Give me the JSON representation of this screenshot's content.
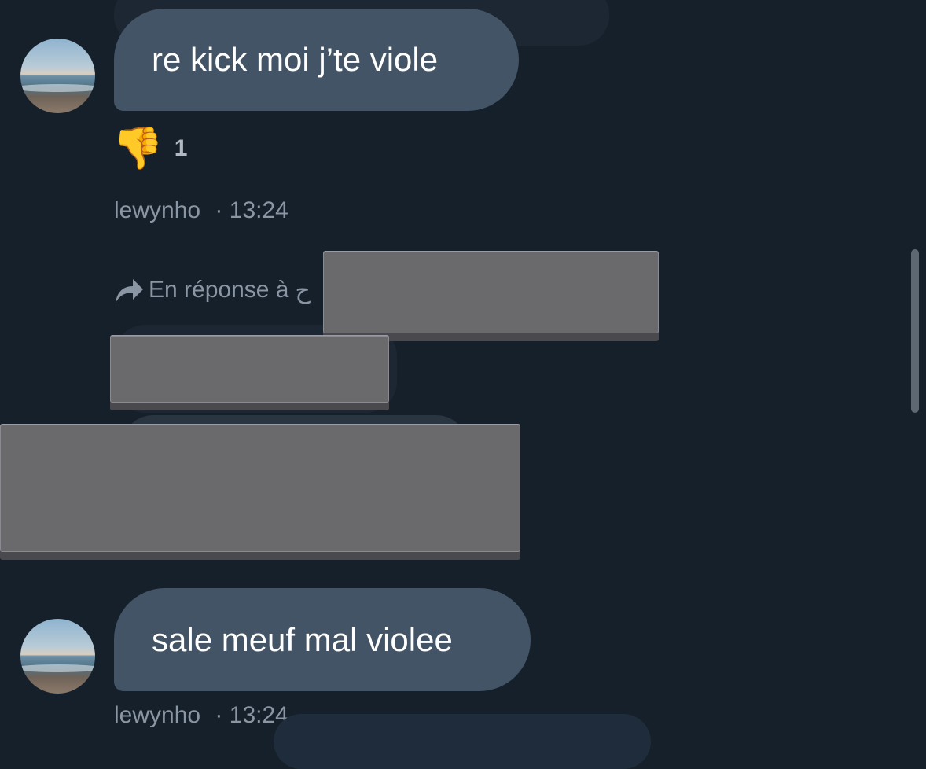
{
  "messages": [
    {
      "text": "re kick moi j’te viole",
      "reaction": {
        "icon": "thumbs-down-icon",
        "glyph": "👎",
        "count": "1"
      },
      "author": "lewynho",
      "separator": "·",
      "time": "13:24"
    },
    {
      "reply_label": "En réponse à",
      "reply_target_partial": "ح",
      "redacted": true
    },
    {
      "text": "sale meuf mal violee",
      "author": "lewynho",
      "separator": "·",
      "time": "13:24"
    }
  ],
  "colors": {
    "background": "#16202b",
    "bubble": "#435466",
    "meta_text": "#8a96a3",
    "redaction": "#6a6a6c"
  }
}
